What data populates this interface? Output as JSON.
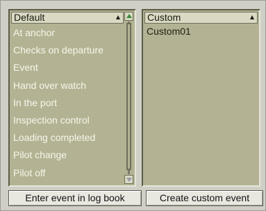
{
  "default_panel": {
    "header": "Default",
    "items": [
      "At anchor",
      "Checks on departure",
      "Event",
      "Hand over watch",
      "In the port",
      "Inspection control",
      "Loading completed",
      "Pilot change",
      "Pilot off"
    ],
    "scroll_position": 0
  },
  "custom_panel": {
    "header": "Custom",
    "items": [
      "Custom01"
    ]
  },
  "buttons": {
    "enter_event": "Enter event in log book",
    "create_custom": "Create custom event"
  },
  "colors": {
    "list_background": "#b3b394",
    "header_background": "#d9d9c4",
    "scroll_up_arrow": "#3c8c3c"
  },
  "icons": {
    "sort": "sort-ascending-icon",
    "scroll_up": "scroll-up-arrow-icon",
    "scroll_down": "scroll-down-arrow-icon"
  }
}
